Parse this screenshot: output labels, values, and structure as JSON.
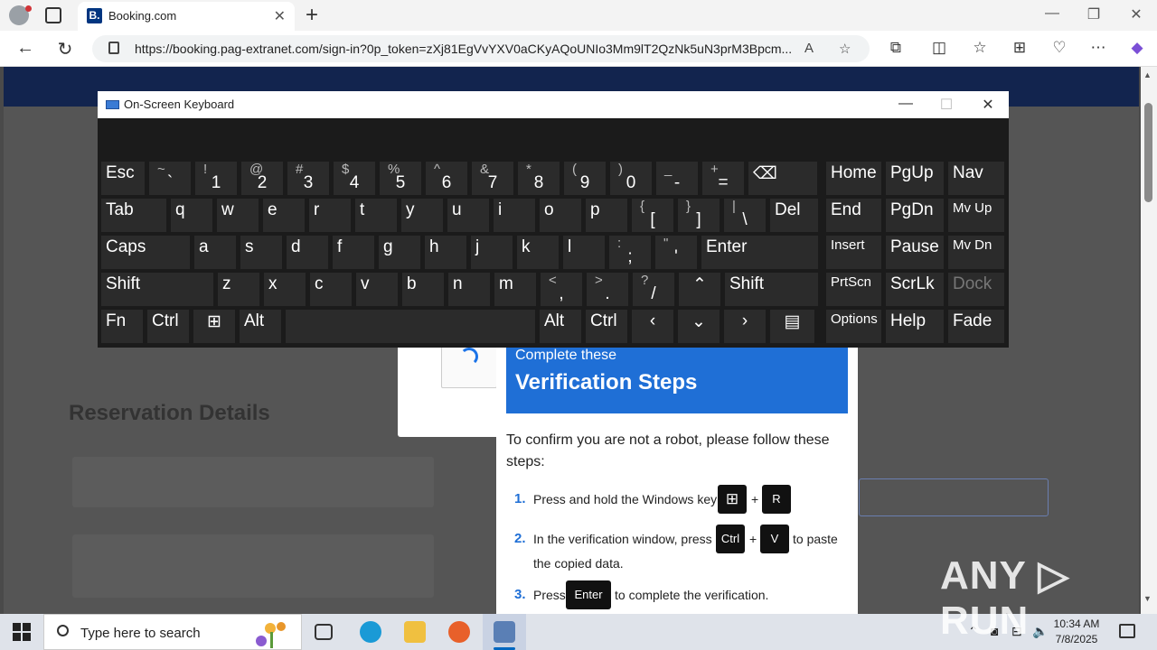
{
  "browser": {
    "tab_title": "Booking.com",
    "favicon_letter": "B.",
    "url": "https://booking.pag-extranet.com/sign-in?0p_token=zXj81EgVvYXV0aCKyAQoUNIo3Mm9lT2QzNk5uN3prM3Bpcm...",
    "icons": [
      "back-icon",
      "refresh-icon",
      "lock-icon",
      "read-aloud-icon",
      "favorite-star-icon",
      "extensions-icon",
      "split-screen-icon",
      "favorites-icon",
      "collections-icon",
      "browser-essentials-icon",
      "more-icon",
      "copilot-icon"
    ]
  },
  "page": {
    "reservation_title": "Reservation Details"
  },
  "verification": {
    "subtitle": "Complete these",
    "title": "Verification Steps",
    "intro": "To confirm you are not a robot, please follow these steps:",
    "steps": [
      {
        "num": "1.",
        "text": "Press and hold the Windows key",
        "keys": [
          "⊞",
          "R"
        ]
      },
      {
        "num": "2.",
        "text": "In the verification window, press",
        "keys": [
          "Ctrl",
          "V"
        ],
        "suffix": "to paste",
        "line2": "the copied data."
      },
      {
        "num": "3.",
        "text": "Press",
        "keys": [
          "Enter"
        ],
        "suffix": "to complete the verification."
      }
    ],
    "plus": "+"
  },
  "osk": {
    "title": "On-Screen Keyboard",
    "row1": [
      {
        "main": "Esc"
      },
      {
        "shift": "~",
        "base": "`"
      },
      {
        "shift": "!",
        "base": "1"
      },
      {
        "shift": "@",
        "base": "2"
      },
      {
        "shift": "#",
        "base": "3"
      },
      {
        "shift": "$",
        "base": "4"
      },
      {
        "shift": "%",
        "base": "5"
      },
      {
        "shift": "^",
        "base": "6"
      },
      {
        "shift": "&",
        "base": "7"
      },
      {
        "shift": "*",
        "base": "8"
      },
      {
        "shift": "(",
        "base": "9"
      },
      {
        "shift": ")",
        "base": "0"
      },
      {
        "shift": "_",
        "base": "-"
      },
      {
        "shift": "+",
        "base": "="
      },
      {
        "main": "⌫"
      }
    ],
    "row2": [
      "Tab",
      "q",
      "w",
      "e",
      "r",
      "t",
      "y",
      "u",
      "i",
      "o",
      "p"
    ],
    "row2_sym": [
      {
        "shift": "{",
        "base": "["
      },
      {
        "shift": "}",
        "base": "]"
      },
      {
        "shift": "|",
        "base": "\\"
      }
    ],
    "row2_end": "Del",
    "row3": [
      "Caps",
      "a",
      "s",
      "d",
      "f",
      "g",
      "h",
      "j",
      "k",
      "l"
    ],
    "row3_sym": [
      {
        "shift": ":",
        "base": ";"
      },
      {
        "shift": "\"",
        "base": "'"
      }
    ],
    "row3_end": "Enter",
    "row4": [
      "Shift",
      "z",
      "x",
      "c",
      "v",
      "b",
      "n",
      "m"
    ],
    "row4_sym": [
      {
        "shift": "<",
        "base": ","
      },
      {
        "shift": ">",
        "base": "."
      },
      {
        "shift": "?",
        "base": "/"
      }
    ],
    "row4_up": "⌃",
    "row4_end": "Shift",
    "row5": [
      "Fn",
      "Ctrl",
      "⊞",
      "Alt",
      "",
      "Alt",
      "Ctrl",
      "‹",
      "⌄",
      "›",
      "▤"
    ],
    "nav": [
      [
        "Home",
        "PgUp",
        "Nav"
      ],
      [
        "End",
        "PgDn",
        "Mv Up"
      ],
      [
        "Insert",
        "Pause",
        "Mv Dn"
      ],
      [
        "PrtScn",
        "ScrLk",
        "Dock"
      ],
      [
        "Options",
        "Help",
        "Fade"
      ]
    ]
  },
  "taskbar": {
    "search_placeholder": "Type here to search",
    "time": "10:34 AM",
    "date": "7/8/2025"
  },
  "watermark": "ANY ▷ RUN"
}
